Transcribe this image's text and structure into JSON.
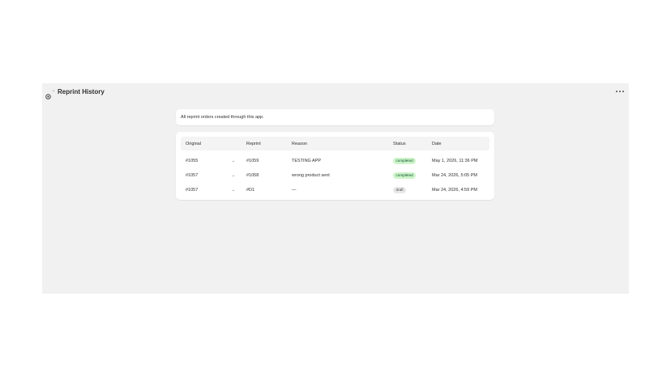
{
  "header": {
    "title": "Reprint History",
    "breadcrumb_separator": "›",
    "app_icon": "app-icon",
    "more_icon": "more-horizontal-icon"
  },
  "info": {
    "text": "All reprint orders created through this app."
  },
  "table": {
    "columns": {
      "original": "Original",
      "reprint": "Reprint",
      "reason": "Reason",
      "status": "Status",
      "date": "Date"
    },
    "rows": [
      {
        "original": "#1055",
        "arrow": "→",
        "reprint": "#1059",
        "reason": "TESTING APP",
        "status": "completed",
        "date": "May 1, 2026, 11:36 PM"
      },
      {
        "original": "#1057",
        "arrow": "→",
        "reprint": "#1058",
        "reason": "wrong product sent",
        "status": "completed",
        "date": "Mar 24, 2026, 5:05 PM"
      },
      {
        "original": "#1057",
        "arrow": "→",
        "reprint": "#D1",
        "reason": "—",
        "status": "draft",
        "date": "Mar 24, 2026, 4:59 PM"
      }
    ]
  },
  "colors": {
    "frame_bg": "#f1f1f1",
    "card_bg": "#ffffff",
    "badge_completed_bg": "#cdf4c9",
    "badge_draft_bg": "#e8e8e8"
  }
}
